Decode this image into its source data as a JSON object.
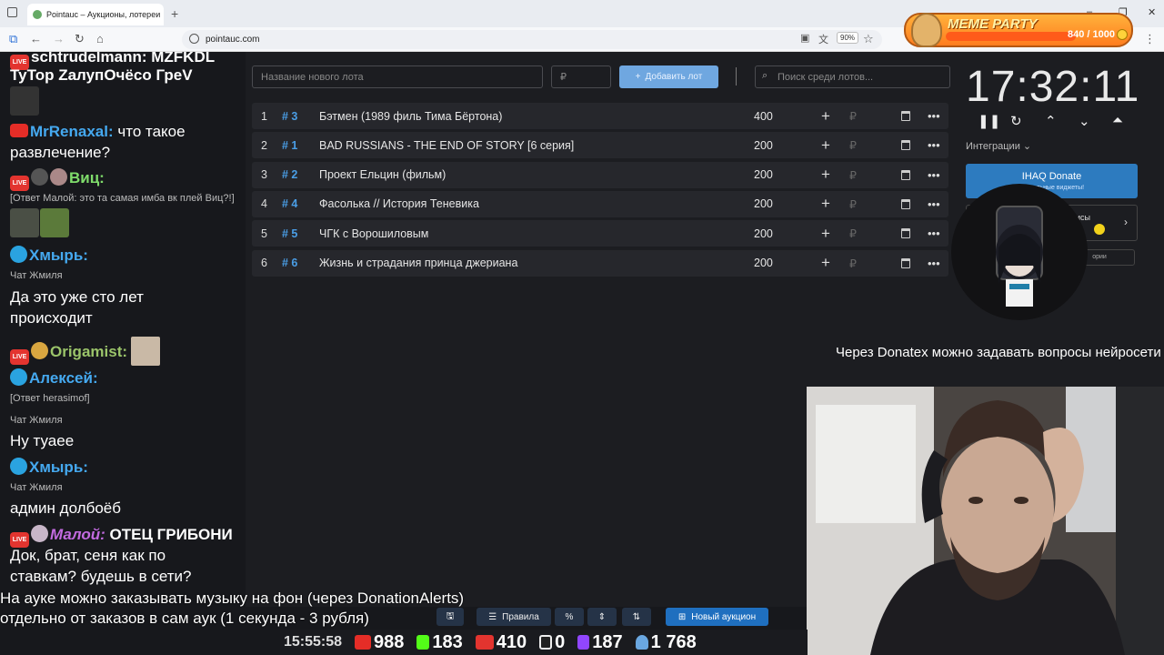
{
  "browser": {
    "tab_title": "Pointauc – Аукционы, лотереи",
    "url": "pointauc.com",
    "zoom": "90%"
  },
  "meme_party": {
    "title": "MEME PARTY",
    "count": "840 / 1000",
    "progress": 0.84
  },
  "chat": {
    "m1_line1": "schtrudelmann: MZFKDL",
    "m1_line2": "TyTop   ZалупОчёсо ГреV",
    "m2_nick": "MrRenaxal:",
    "m2_text": " что такое",
    "m2_line2": "развлечение?",
    "m3_nick": "Виц:",
    "m3_reply": "[Ответ Малой: это та самая имба вк плей Виц?!]",
    "m4_nick": "Хмырь:",
    "m4_sub": "Чат Жмиля",
    "m4_line1": "Да это уже сто лет",
    "m4_line2": "происходит",
    "m5_nick": "Origamist:",
    "m6_nick": "Алексей:",
    "m6_reply": "[Ответ herasimof]",
    "m7_sub": "Чат Жмиля",
    "m7_text": "Ну туаее",
    "m8_nick": "Хмырь:",
    "m8_sub": "Чат Жмиля",
    "m8_text": "админ долбоёб",
    "m9_nick": "Малой:",
    "m9_text": " ОТЕЦ ГРИБОНИ",
    "m9_line2": "Док, брат, сеня как по",
    "m9_line3": "ставкам? будешь в сети?"
  },
  "auction": {
    "new_lot_placeholder": "Название нового лота",
    "amount_placeholder": "₽",
    "add_button": "Добавить лот",
    "search_placeholder": "Поиск среди лотов...",
    "lots": [
      {
        "n": "1",
        "id": "# 3",
        "name": "Бэтмен (1989 филь Тима Бёртона)",
        "amount": "400"
      },
      {
        "n": "2",
        "id": "# 1",
        "name": "BAD RUSSIANS - THE END OF STORY [6 серия]",
        "amount": "200"
      },
      {
        "n": "3",
        "id": "# 2",
        "name": "Проект Ельцин (фильм)",
        "amount": "200"
      },
      {
        "n": "4",
        "id": "# 4",
        "name": "Фасолька // История Теневика",
        "amount": "200"
      },
      {
        "n": "5",
        "id": "# 5",
        "name": "ЧГК с Ворошиловым",
        "amount": "200"
      },
      {
        "n": "6",
        "id": "# 6",
        "name": "Жизнь и страдания принца джериана",
        "amount": "200"
      }
    ],
    "currency": "₽"
  },
  "sidebar": {
    "clock": "17:32:11",
    "integrations": "Интеграции",
    "ihaq_title": "IHAQ Donate",
    "ihaq_sub": "уникальные виджеты!",
    "card2_label": "исы",
    "card3_label": "ории"
  },
  "overlay": {
    "donatex": "Через Donatex можно задавать вопросы нейросети",
    "note_line1": "На ауке можно заказывать музыку на фон (через DonationAlerts)",
    "note_line2": "отдельно от заказов в сам аук (1 секунда - 3 рубля)"
  },
  "toolbar": {
    "rules": "Правила",
    "new_auction": "Новый аукцион"
  },
  "stats": {
    "time": "15:55:58",
    "youtube": "988",
    "kick": "183",
    "vkplay": "410",
    "rutube": "0",
    "twitch": "187",
    "total": "1 768"
  },
  "colors": {
    "accent": "#4a9ee6",
    "add_button": "#6fa7e0",
    "new_auction": "#1f6fbf",
    "ihaq": "#2d7bbf",
    "youtube": "#e52d27",
    "kick": "#53fc18",
    "twitch": "#9146ff",
    "telegram": "#2aa3e0"
  }
}
